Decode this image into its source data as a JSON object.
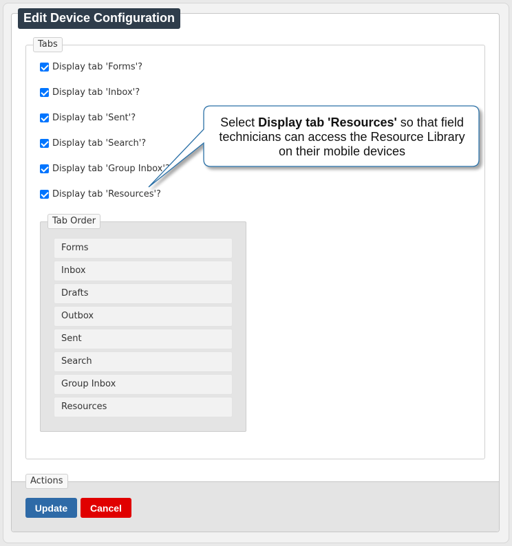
{
  "panel": {
    "title": "Edit Device Configuration"
  },
  "tabs_section": {
    "legend": "Tabs",
    "checkboxes": [
      {
        "label": "Display tab 'Forms'?",
        "checked": true
      },
      {
        "label": "Display tab 'Inbox'?",
        "checked": true
      },
      {
        "label": "Display tab 'Sent'?",
        "checked": true
      },
      {
        "label": "Display tab 'Search'?",
        "checked": true
      },
      {
        "label": "Display tab 'Group Inbox'?",
        "checked": true
      },
      {
        "label": "Display tab 'Resources'?",
        "checked": true
      }
    ]
  },
  "tab_order": {
    "legend": "Tab Order",
    "items": [
      "Forms",
      "Inbox",
      "Drafts",
      "Outbox",
      "Sent",
      "Search",
      "Group Inbox",
      "Resources"
    ]
  },
  "actions": {
    "legend": "Actions",
    "update_label": "Update",
    "cancel_label": "Cancel"
  },
  "callout": {
    "prefix": "Select ",
    "bold": "Display tab 'Resources'",
    "suffix": " so that field technicians can access the Resource Library on their mobile devices"
  },
  "colors": {
    "title_bg": "#2f3d4b",
    "checkbox": "#0075ff",
    "update_button": "#2e6aa7",
    "cancel_button": "#e00000",
    "callout_border": "#2a6fa6"
  }
}
